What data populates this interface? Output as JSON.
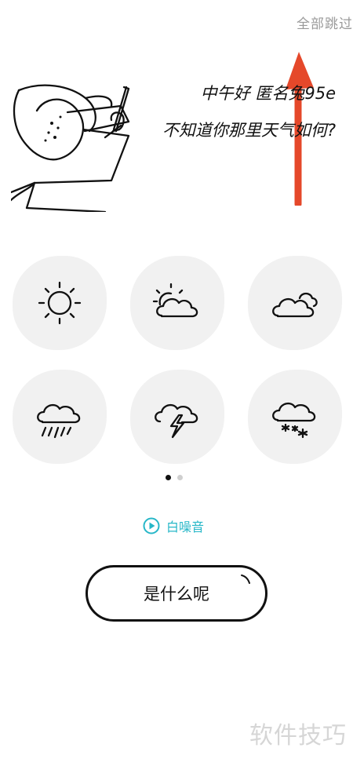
{
  "skip_label": "全部跳过",
  "greeting": {
    "line1": "中午好  匿名兔95e",
    "line2": "不知道你那里天气如何?"
  },
  "weather_options": [
    {
      "icon": "sun-icon"
    },
    {
      "icon": "partly-cloudy-icon"
    },
    {
      "icon": "cloudy-icon"
    },
    {
      "icon": "rain-icon"
    },
    {
      "icon": "thunderstorm-icon"
    },
    {
      "icon": "snow-icon"
    }
  ],
  "pagination": {
    "current": 1,
    "total": 2
  },
  "white_noise_label": "白噪音",
  "cta_label": "是什么呢",
  "watermark": "软件技巧",
  "colors": {
    "accent": "#27b7c8",
    "arrow": "#e5482a",
    "cell_bg": "#f1f1f1"
  }
}
